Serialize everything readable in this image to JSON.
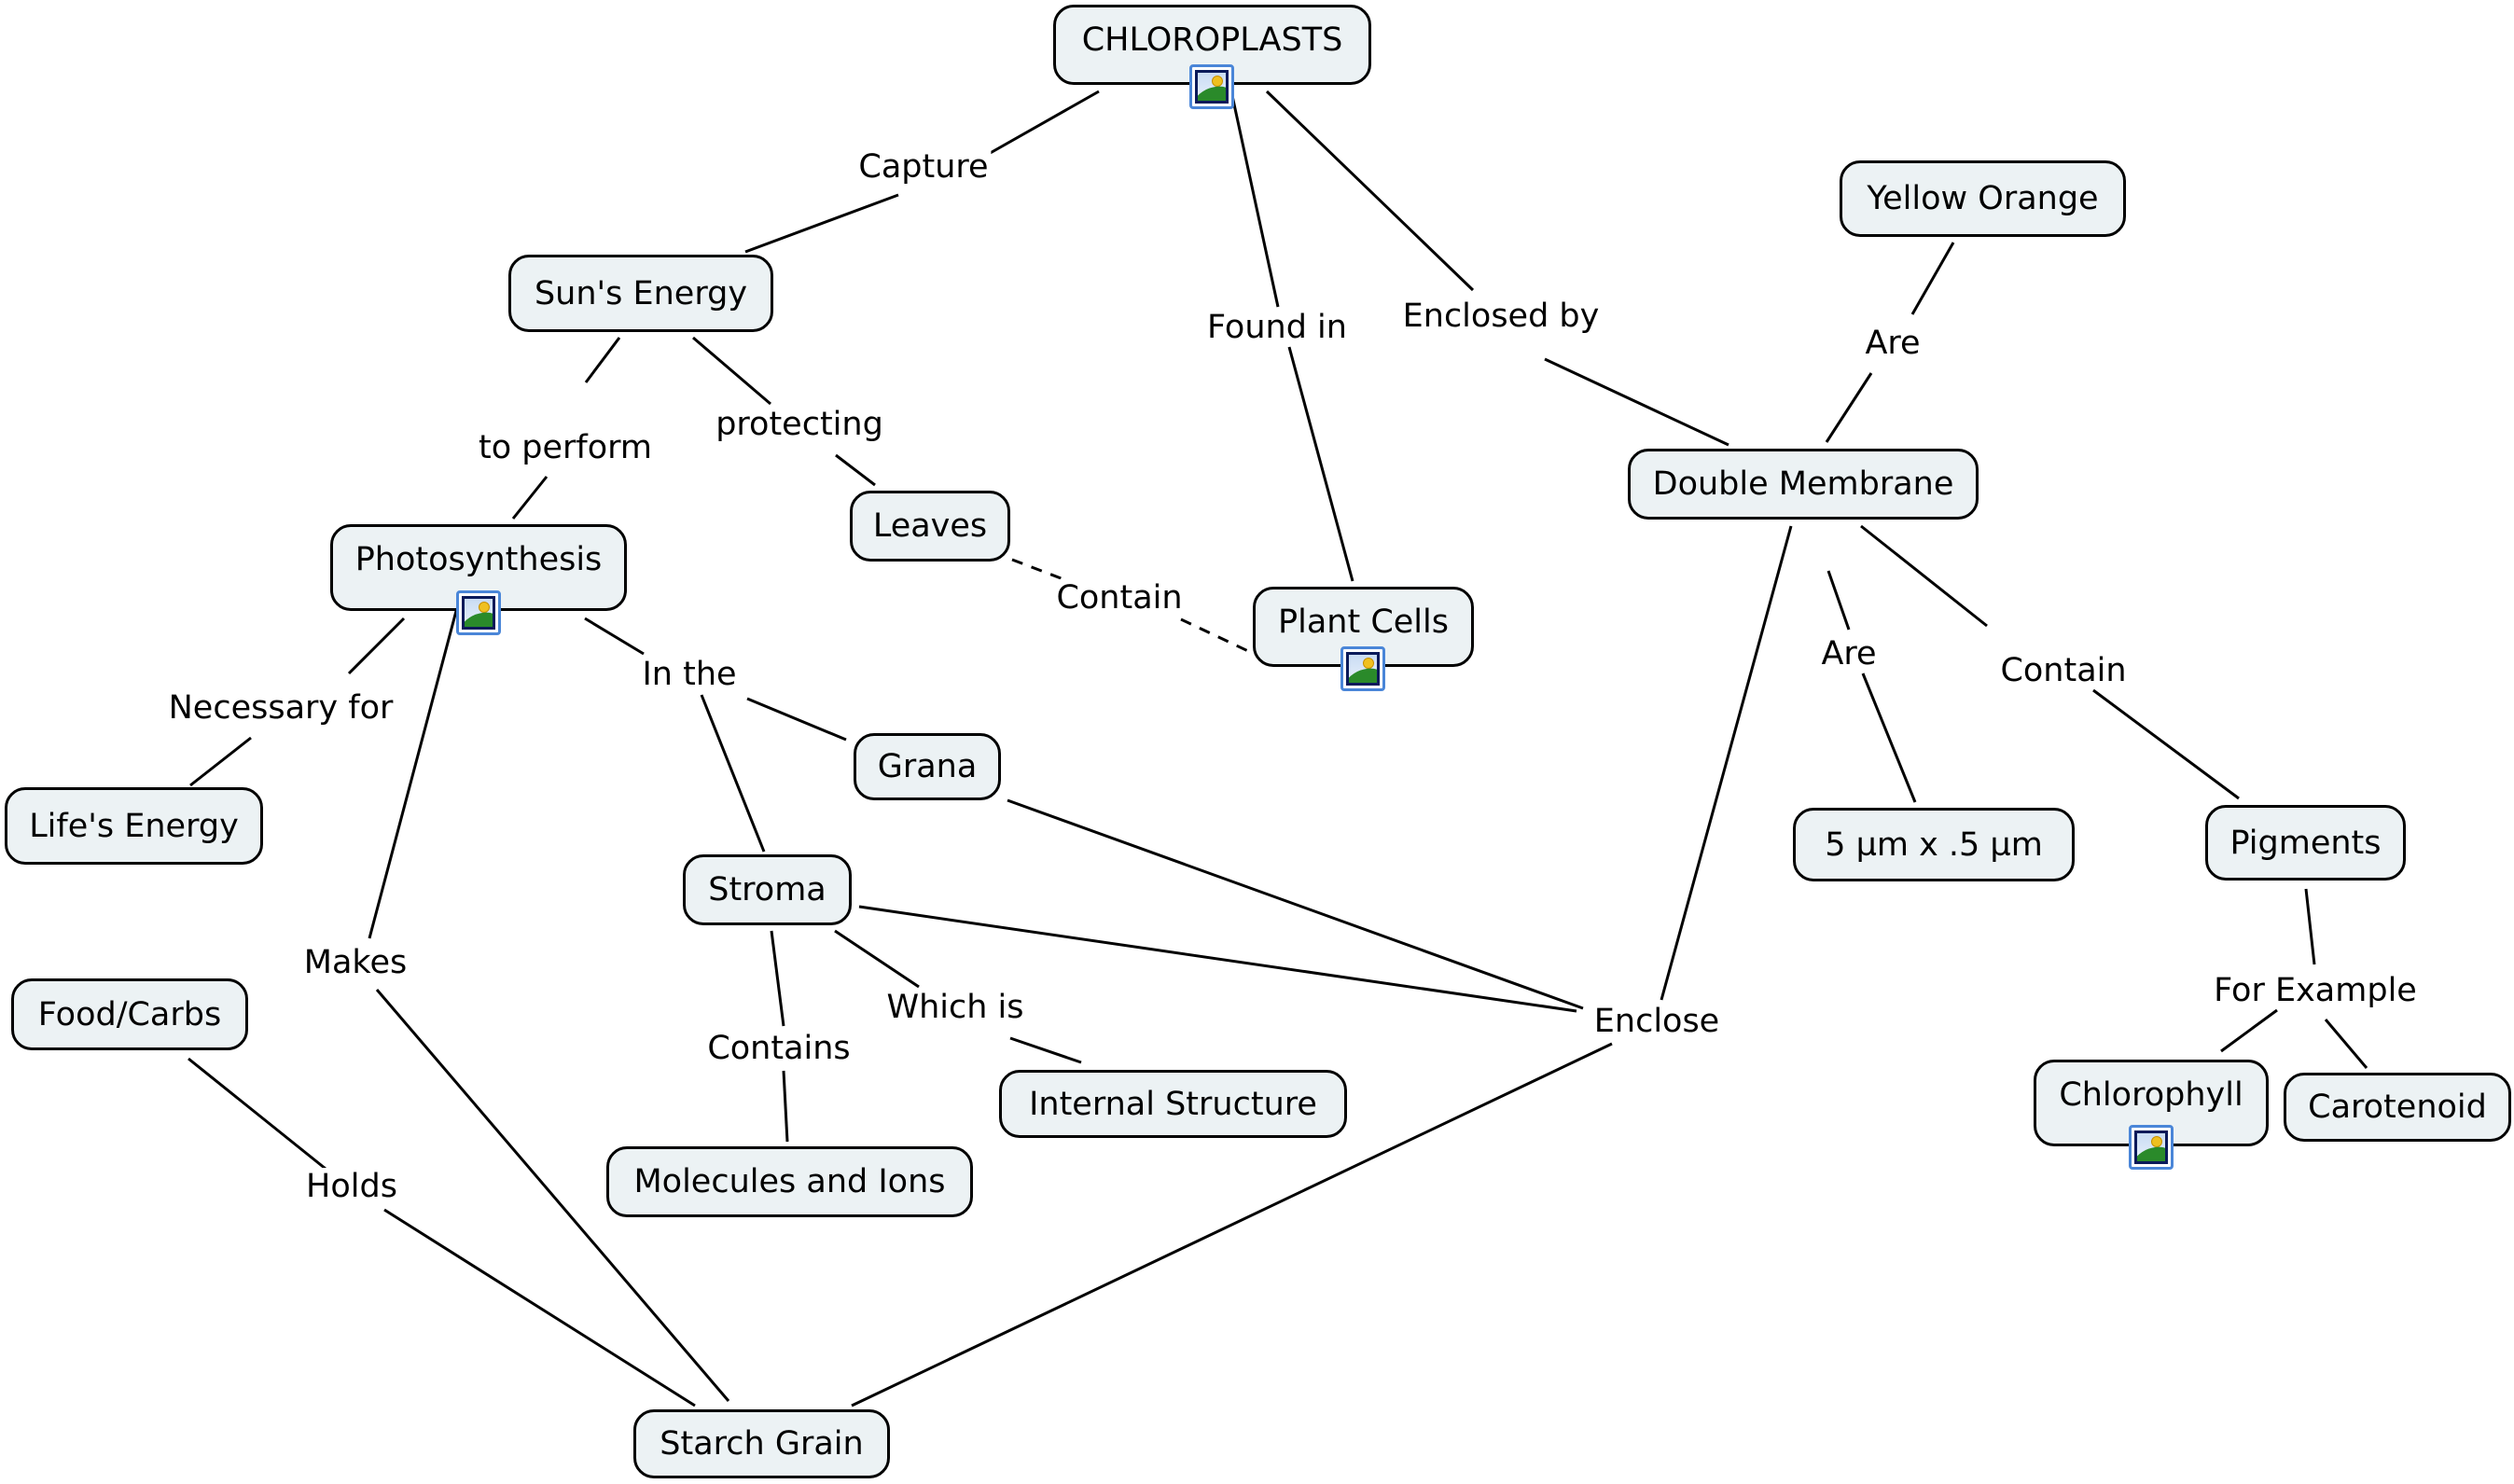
{
  "title": "CHLOROPLASTS",
  "colors": {
    "node_fill": "#ecf2f4",
    "node_border": "#000000",
    "line": "#000000",
    "image_icon_border": "#4a86d8"
  },
  "nodes": [
    {
      "id": "chloroplasts",
      "text": "CHLOROPLASTS",
      "has_image": true
    },
    {
      "id": "suns-energy",
      "text": "Sun's Energy",
      "has_image": false
    },
    {
      "id": "yellow-orange",
      "text": "Yellow Orange",
      "has_image": false
    },
    {
      "id": "double-membrane",
      "text": "Double Membrane",
      "has_image": false
    },
    {
      "id": "photosynthesis",
      "text": "Photosynthesis",
      "has_image": true
    },
    {
      "id": "leaves",
      "text": "Leaves",
      "has_image": false
    },
    {
      "id": "plant-cells",
      "text": "Plant Cells",
      "has_image": true
    },
    {
      "id": "grana",
      "text": "Grana",
      "has_image": false
    },
    {
      "id": "lifes-energy",
      "text": "Life's Energy",
      "has_image": false
    },
    {
      "id": "stroma",
      "text": "Stroma",
      "has_image": false
    },
    {
      "id": "size",
      "text": "5 µm x .5 µm",
      "has_image": false
    },
    {
      "id": "pigments",
      "text": "Pigments",
      "has_image": false
    },
    {
      "id": "food-carbs",
      "text": "Food/Carbs",
      "has_image": false
    },
    {
      "id": "internal-structure",
      "text": "Internal Structure",
      "has_image": false
    },
    {
      "id": "molecules-and-ions",
      "text": "Molecules and Ions",
      "has_image": false
    },
    {
      "id": "chlorophyll",
      "text": "Chlorophyll",
      "has_image": true
    },
    {
      "id": "carotenoid",
      "text": "Carotenoid",
      "has_image": false
    },
    {
      "id": "starch-grain",
      "text": "Starch Grain",
      "has_image": false
    }
  ],
  "linking_phrases": [
    {
      "id": "capture",
      "text": "Capture",
      "from": [
        "chloroplasts"
      ],
      "to": [
        "suns-energy"
      ]
    },
    {
      "id": "found-in",
      "text": "Found in",
      "from": [
        "chloroplasts"
      ],
      "to": [
        "plant-cells"
      ]
    },
    {
      "id": "enclosed-by",
      "text": "Enclosed by",
      "from": [
        "chloroplasts"
      ],
      "to": [
        "double-membrane"
      ]
    },
    {
      "id": "are-color",
      "text": "Are",
      "from": [
        "double-membrane"
      ],
      "to": [
        "yellow-orange"
      ]
    },
    {
      "id": "to-perform",
      "text": "to perform",
      "from": [
        "suns-energy"
      ],
      "to": [
        "photosynthesis"
      ]
    },
    {
      "id": "protecting",
      "text": "protecting",
      "from": [
        "suns-energy"
      ],
      "to": [
        "leaves"
      ]
    },
    {
      "id": "contain-cells",
      "text": "Contain",
      "from": [
        "leaves"
      ],
      "to": [
        "plant-cells"
      ],
      "dashed": true
    },
    {
      "id": "necessary-for",
      "text": "Necessary for",
      "from": [
        "photosynthesis"
      ],
      "to": [
        "lifes-energy"
      ]
    },
    {
      "id": "in-the",
      "text": "In the",
      "from": [
        "photosynthesis"
      ],
      "to": [
        "grana",
        "stroma"
      ]
    },
    {
      "id": "makes",
      "text": "Makes",
      "from": [
        "photosynthesis"
      ],
      "to": [
        "starch-grain"
      ]
    },
    {
      "id": "are-size",
      "text": "Are",
      "from": [
        "double-membrane"
      ],
      "to": [
        "size"
      ]
    },
    {
      "id": "contain-pigments",
      "text": "Contain",
      "from": [
        "double-membrane"
      ],
      "to": [
        "pigments"
      ]
    },
    {
      "id": "enclose",
      "text": "Enclose",
      "from": [
        "double-membrane"
      ],
      "to": [
        "grana",
        "stroma",
        "starch-grain"
      ]
    },
    {
      "id": "contains",
      "text": "Contains",
      "from": [
        "stroma"
      ],
      "to": [
        "molecules-and-ions"
      ]
    },
    {
      "id": "which-is",
      "text": "Which is",
      "from": [
        "stroma"
      ],
      "to": [
        "internal-structure"
      ]
    },
    {
      "id": "for-example",
      "text": "For Example",
      "from": [
        "pigments"
      ],
      "to": [
        "chlorophyll",
        "carotenoid"
      ]
    },
    {
      "id": "holds",
      "text": "Holds",
      "from": [
        "food-carbs"
      ],
      "to": [
        "starch-grain"
      ]
    }
  ]
}
